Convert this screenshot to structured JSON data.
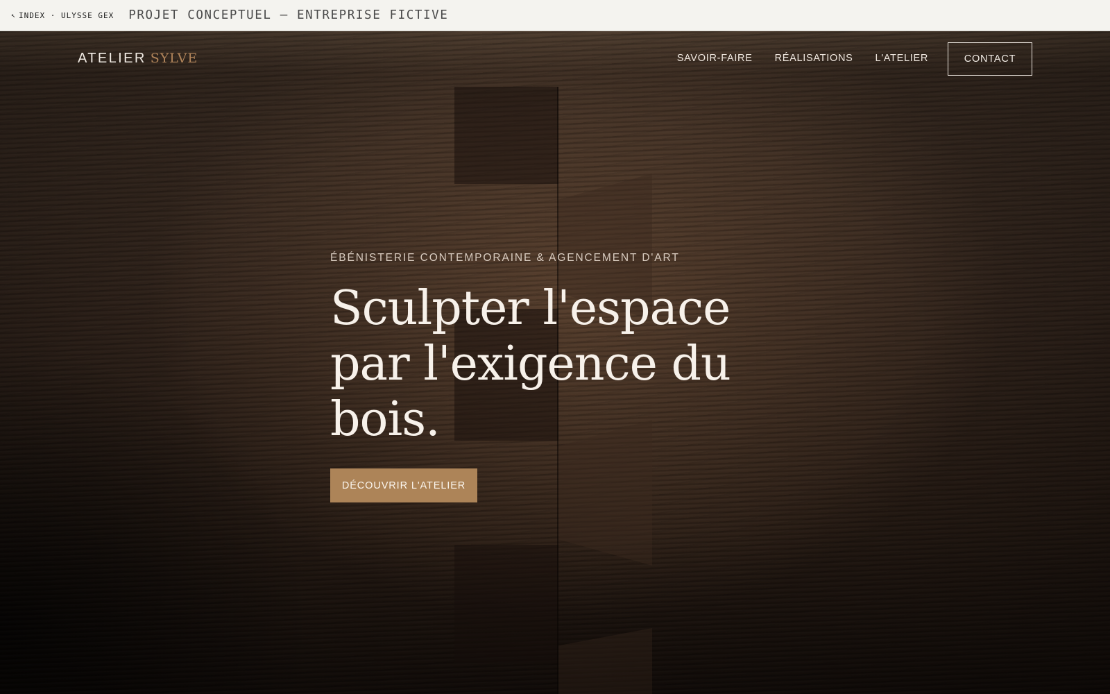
{
  "topbar": {
    "index_arrow": "↖",
    "index_label": "INDEX · ULYSSE GEX",
    "project_label": "PROJET CONCEPTUEL — ENTREPRISE FICTIVE"
  },
  "brand": {
    "word1": "ATELIER",
    "word2": "SYLVE"
  },
  "nav": {
    "items": [
      {
        "label": "SAVOIR-FAIRE"
      },
      {
        "label": "RÉALISATIONS"
      },
      {
        "label": "L'ATELIER"
      }
    ],
    "contact_label": "CONTACT"
  },
  "hero": {
    "eyebrow": "ÉBÉNISTERIE CONTEMPORAINE & AGENCEMENT D'ART",
    "headline": "Sculpter l'espace par l'exigence du bois.",
    "cta_label": "DÉCOUVRIR L'ATELIER",
    "background_image": "dark walnut dovetail joint close-up"
  },
  "colors": {
    "accent": "#ad8458",
    "text_light": "#f7f1ea",
    "topbar_bg": "#f4f3ef"
  }
}
